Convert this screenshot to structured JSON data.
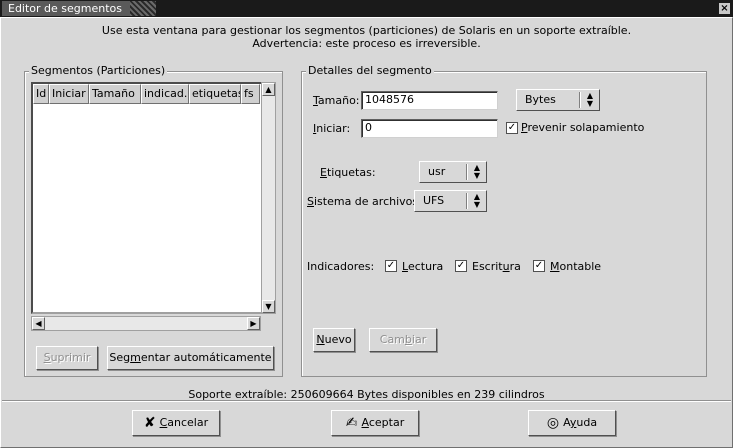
{
  "window": {
    "title": "Editor de segmentos",
    "close_glyph": "×"
  },
  "intro": {
    "line1": "Use esta ventana para gestionar los segmentos (particiones) de Solaris en un soporte extraíble.",
    "line2": "Advertencia: este proceso es irreversible."
  },
  "segments": {
    "legend": "Segmentos (Particiones)",
    "columns": [
      "Id",
      "Iniciar",
      "Tamaño",
      "indicad...",
      "etiquetas",
      "fs"
    ],
    "rows": [],
    "delete_button": {
      "prefix": "",
      "mnemonic": "S",
      "suffix": "uprimir"
    },
    "auto_button": {
      "prefix": "Seg",
      "mnemonic": "m",
      "suffix": "entar automáticamente"
    }
  },
  "details": {
    "legend": "Detalles del segmento",
    "size_label": {
      "prefix": "",
      "mnemonic": "T",
      "suffix": "amaño:"
    },
    "size_value": "1048576",
    "unit_value": "Bytes",
    "start_label": {
      "prefix": "",
      "mnemonic": "I",
      "suffix": "niciar:"
    },
    "start_value": "0",
    "prevent_overlap": {
      "checked": true,
      "prefix": "",
      "mnemonic": "P",
      "suffix": "revenir solapamiento"
    },
    "tags_label": {
      "prefix": "",
      "mnemonic": "E",
      "suffix": "tiquetas:"
    },
    "tags_value": "usr",
    "fs_label": {
      "prefix": "",
      "mnemonic": "S",
      "suffix": "istema de archivos:"
    },
    "fs_value": "UFS",
    "flags_label": "Indicadores:",
    "flag_read": {
      "checked": true,
      "prefix": "",
      "mnemonic": "L",
      "suffix": "ectura"
    },
    "flag_write": {
      "checked": true,
      "prefix": "Escrit",
      "mnemonic": "u",
      "suffix": "ra"
    },
    "flag_mount": {
      "checked": true,
      "prefix": "",
      "mnemonic": "M",
      "suffix": "ontable"
    },
    "new_button": {
      "prefix": "",
      "mnemonic": "N",
      "suffix": "uevo"
    },
    "change_button": {
      "prefix": "Cam",
      "mnemonic": "b",
      "suffix": "iar"
    }
  },
  "status": "Soporte extraíble: 250609664 Bytes disponibles en 239 cilindros",
  "footer": {
    "cancel": {
      "icon": "cancel-icon",
      "prefix": "",
      "mnemonic": "C",
      "suffix": "ancelar"
    },
    "accept": {
      "icon": "accept-icon",
      "prefix": "",
      "mnemonic": "A",
      "suffix": "ceptar"
    },
    "help": {
      "icon": "help-icon",
      "prefix": "A",
      "mnemonic": "y",
      "suffix": "uda"
    }
  },
  "check_glyph": "✓"
}
